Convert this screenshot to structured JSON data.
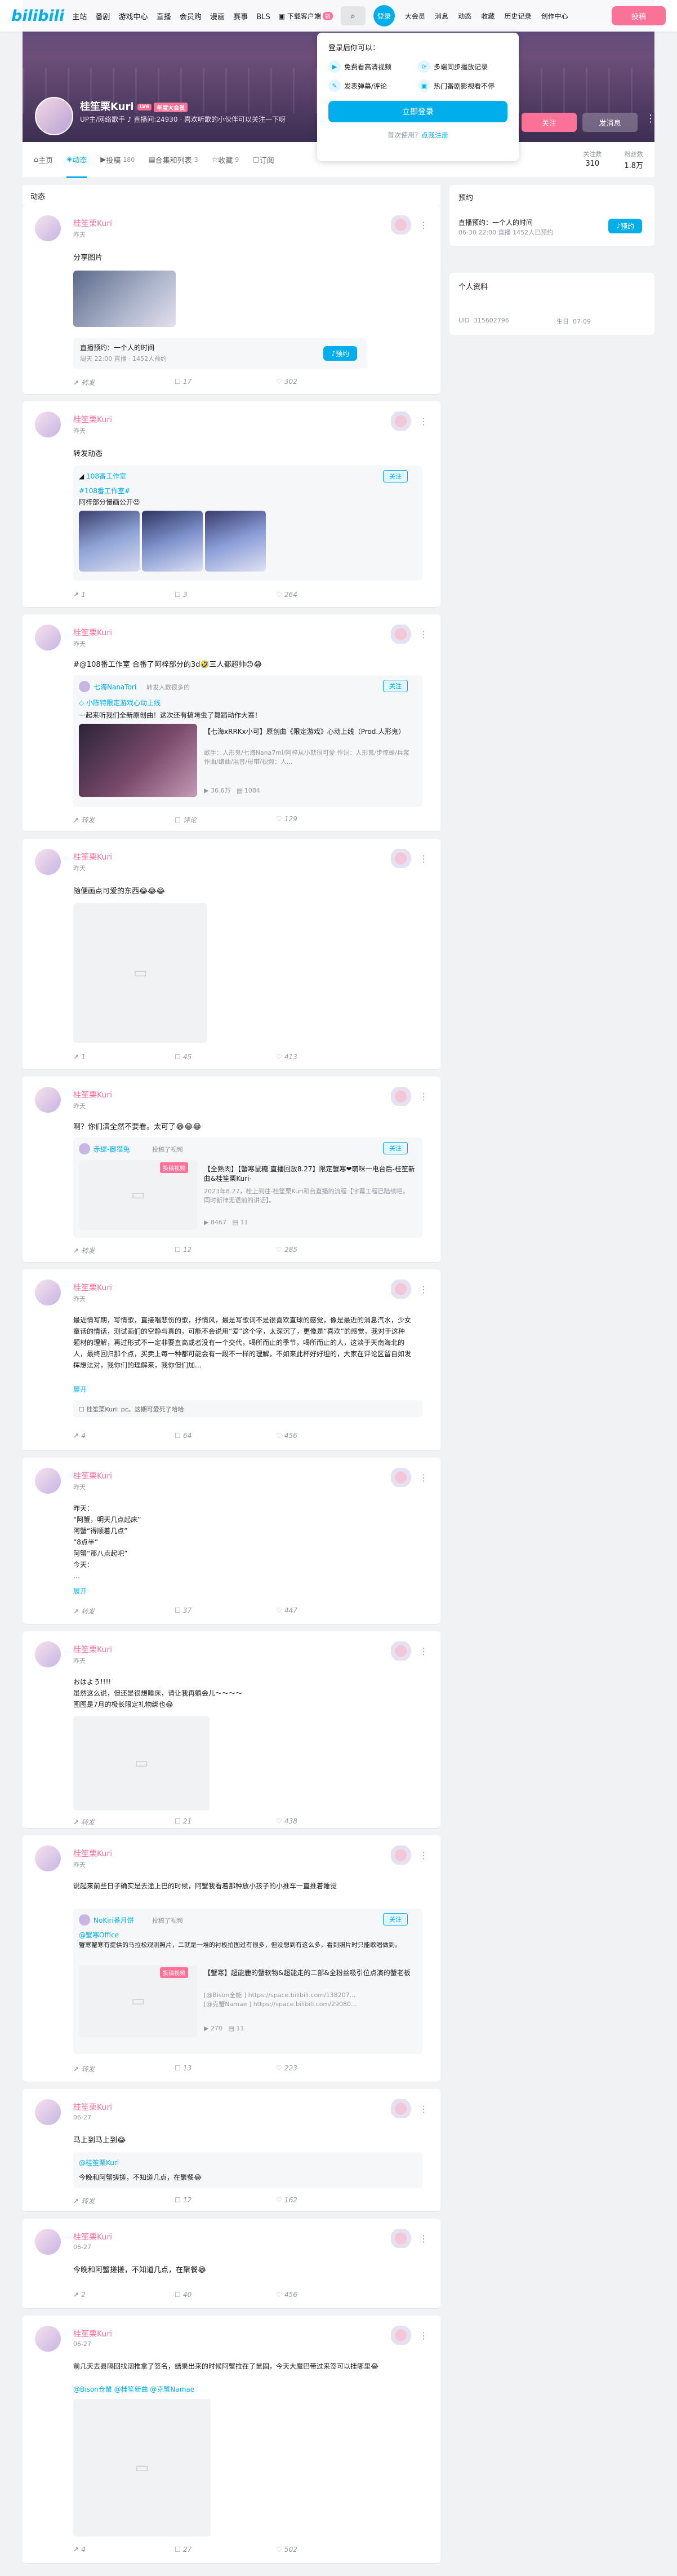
{
  "header": {
    "logo": "bilibili",
    "nav": [
      "主站",
      "番剧",
      "游戏中心",
      "直播",
      "会员购",
      "漫画",
      "赛事",
      "BLS"
    ],
    "download": "下载客户端",
    "download_badge": "新",
    "avatar_label": "登录",
    "right_nav": [
      "大会员",
      "消息",
      "动态",
      "收藏",
      "历史记录",
      "创作中心"
    ],
    "post": "投稿"
  },
  "banner": {
    "name": "桂笙栗Kuri",
    "level": "LV6",
    "vip": "年度大会员",
    "sign": "UP主/网络歌手 ♪ 直播间:24930 · 喜欢听歌的小伙伴可以关注一下呀",
    "follow": "关注",
    "message": "发消息",
    "more": "⋮"
  },
  "tabs": [
    {
      "label": "主页",
      "count": ""
    },
    {
      "label": "动态",
      "count": ""
    },
    {
      "label": "投稿",
      "count": "180"
    },
    {
      "label": "合集和列表",
      "count": "3"
    },
    {
      "label": "收藏",
      "count": "9"
    },
    {
      "label": "订阅",
      "count": ""
    }
  ],
  "stats": [
    {
      "k": "关注数",
      "v": "310"
    },
    {
      "k": "粉丝数",
      "v": "1.8万"
    }
  ],
  "popup": {
    "title": "登录后你可以：",
    "features": [
      "免费看高清视频",
      "多端同步播放记录",
      "发表弹幕/评论",
      "热门番剧影视看不停"
    ],
    "login": "立即登录",
    "register_prefix": "首次使用？",
    "register": "点我注册"
  },
  "feed_header": "动态",
  "sidebar": {
    "notice_title": "预约",
    "notice_item": "直播预约：一个人的时间",
    "notice_time": "06-30 22:00 直播 1452人已预约",
    "notice_btn": "预约",
    "profile_title": "个人资料",
    "uid_label": "UID",
    "uid": "315602796",
    "birth_label": "生日",
    "birth": "07-09"
  },
  "cards": [
    {
      "name": "桂笙栗Kuri",
      "time": "昨天",
      "text": "分享图片",
      "live_title": "直播预约：一个人的时间",
      "live_sub": "周天 22:00 直播 · 1452人预约",
      "live_btn": "预约",
      "share": "转发",
      "comment": "17",
      "like": "302"
    },
    {
      "name": "桂笙栗Kuri",
      "time": "昨天",
      "text": "转发动态",
      "org": "108番工作室",
      "follow": "关注",
      "topic": "#108番工作室#",
      "sub_text": "阿梓部分慢画公开😍",
      "share": "1",
      "comment": "3",
      "like": "264"
    },
    {
      "name": "桂笙栗Kuri",
      "time": "昨天",
      "text": "#@108番工作室 合番了阿梓部分的3d🤣三人都超帅😊😂",
      "inner_name": "七海NanaTori",
      "inner_meta": "转发人数很多的",
      "follow": "关注",
      "inner_tag": "小陈特限定游戏心动上线",
      "inner_text": "一起来听我们全新原创曲！这次还有搞垮虫了舞蹈动作大赛！",
      "video_title": "【七海xRRKx小可】原创曲《限定游戏》心动上线（Prod.人形鬼）",
      "video_sub": "歌手：人形鬼/七海Nana7mi/阿梓从小就很可爱 作词：人形鬼/步惊蝉/兵浆 作曲/编曲/混音/母带/视频：人...",
      "video_play": "36.6万",
      "video_dm": "1084",
      "share": "转发",
      "comment": "评论",
      "like": "129"
    },
    {
      "name": "桂笙栗Kuri",
      "time": "昨天",
      "text": "随便画点可爱的东西😂😂😂",
      "share": "1",
      "comment": "45",
      "like": "413"
    },
    {
      "name": "桂笙栗Kuri",
      "time": "昨天",
      "text": "啊？你们演全然不要看。太可了😂😂😂",
      "inner_name": "赤缇-御猫兔",
      "inner_meta": "投稿了视频",
      "follow": "关注",
      "tag": "投稿视频",
      "video_title": "【全熟肉】【蟹寒鼠糖 直播回放8.27】限定蟹寒❤萌咪一电台后-桂笙新曲&桂笙栗Kuri-",
      "video_sub": "2023年8.27，桂上到往-桂笙栗Kuri和台直播的流程【字幕工程已陆续吧，同时新律无语前的讲话】。",
      "video_play": "8467",
      "video_dm": "11",
      "share": "转发",
      "comment": "12",
      "like": "285"
    },
    {
      "name": "桂笙栗Kuri",
      "time": "昨天",
      "text": "最近情写期，写情歌，直接唱悲伤的歌，抒情风，最是写歌词不是很喜欢直球的感觉，像是最近的消息汽水，少女童话的情话，测试画们的空静与真的，可能不会说用“爱”这个字，太深沉了，更像是“喜欢”的感觉，我对于这种题材的理解，再过形式不一定非要直高或者没有一个交代，喝所而止的季节，喝所而止的人，这淡于天南海北的人，最终回归那个点，买卖上每一种都可能会有一段不一样的理解，不如来此杯好好坦的，大家在评论区留自如发挥想法对，我你们的理解来，我你但们加...",
      "more": "展开",
      "comment_preview": "桂笙栗Kuri: pc。这期可爱死了哈哈",
      "share": "4",
      "comment": "64",
      "like": "456"
    },
    {
      "name": "桂笙栗Kuri",
      "time": "昨天",
      "text": "昨天：\n“阿蟹，明天几点起床”\n阿蟹“得顺着几点”\n“8点半”\n阿蟹“那八点起吧”\n今天：\n…",
      "more": "展开",
      "share": "转发",
      "comment": "37",
      "like": "447"
    },
    {
      "name": "桂笙栗Kuri",
      "time": "昨天",
      "text": "おはよう!!!!\n 虽然这么说，但还是很想睡床，请让我再躺会儿～～～～\n 图图是7月的极长限定礼物绑也😂",
      "share": "转发",
      "comment": "21",
      "like": "438"
    },
    {
      "name": "桂笙栗Kuri",
      "time": "昨天",
      "text": "说起来前些日子确实是去途上巴的时候，阿蟹我看着那种放小孩子的小推车一直推着睡觉",
      "inner_name": "NoKiri番月饼",
      "inner_meta": "投稿了视频",
      "follow": "关注",
      "topic": "@蟹寒Office",
      "sub_text": "蟹寒蟹寒有提供的马拉松观测照片，二就是一堆的衬板拍图过有很多，但没想到有这么多，看到照片时只能歌唱做到。",
      "tag": "投稿视频",
      "video_title": "【蟹寒】超能鹿的蟹软物&超能走的二部&全粉丝吸引位点演的蟹老板",
      "video_sub": "[@Bison全能 ] https://space.bilibili.com/138207...\n[@克蟹Namae ] https://space.bilibili.com/29080...",
      "video_play": "270",
      "video_dm": "11",
      "share": "转发",
      "comment": "13",
      "like": "223"
    },
    {
      "name": "桂笙栗Kuri",
      "time": "06-27",
      "text": "马上到马上到😂",
      "inner_name": "@桂笙栗Kuri",
      "inner_text": "今晚和阿蟹搓搓，不知道几点，在聚餐😂",
      "share": "转发",
      "comment": "12",
      "like": "162"
    },
    {
      "name": "桂笙栗Kuri",
      "time": "06-27",
      "text": "今晚和阿蟹搓搓，不知道几点，在聚餐😂",
      "share": "2",
      "comment": "40",
      "like": "456"
    },
    {
      "name": "桂笙栗Kuri",
      "time": "06-27",
      "text": "前几天去县隔回找阔推拿了签名，结果出来的时候阿蟹拉在了鼠固，今天大魔巴带过来签可以挂哪里😂",
      "mentions": "@Bison仓鼠 @桂笙新曲 @克蟹Namae",
      "share": "4",
      "comment": "27",
      "like": "502"
    }
  ]
}
